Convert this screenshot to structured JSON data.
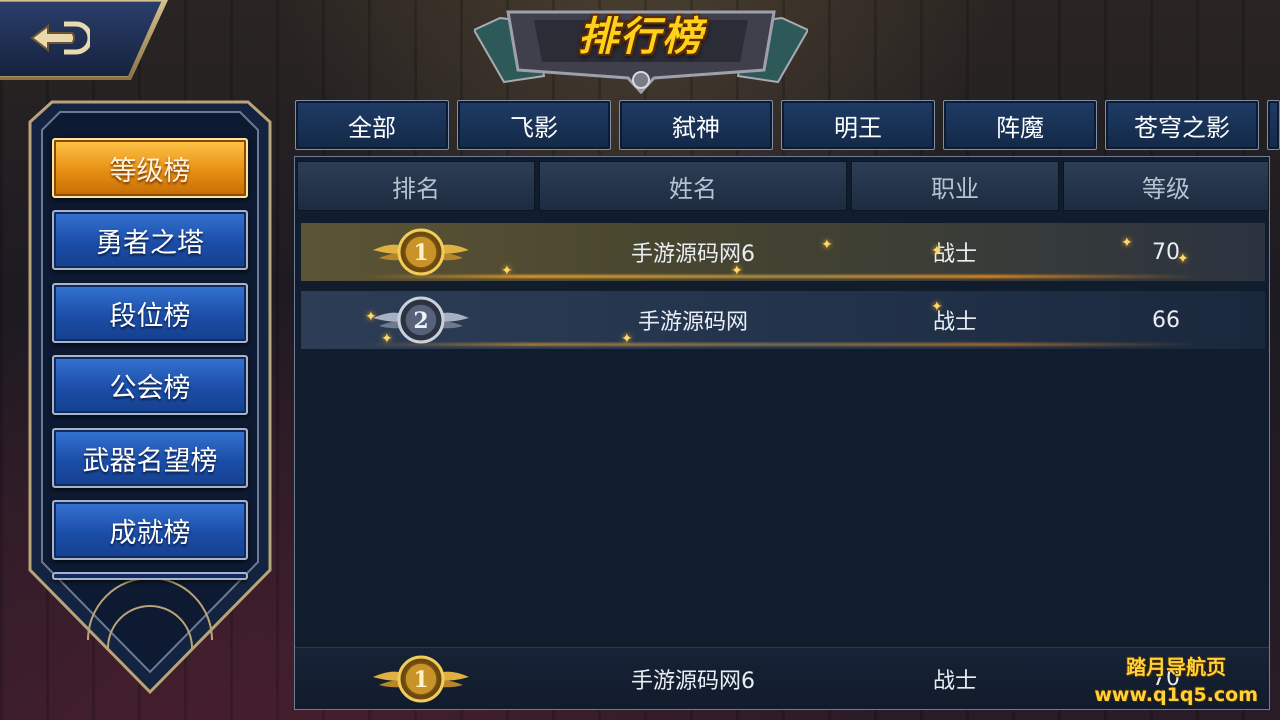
{
  "title": "排行榜",
  "sidebar": {
    "items": [
      {
        "label": "等级榜",
        "active": true
      },
      {
        "label": "勇者之塔",
        "active": false
      },
      {
        "label": "段位榜",
        "active": false
      },
      {
        "label": "公会榜",
        "active": false
      },
      {
        "label": "武器名望榜",
        "active": false
      },
      {
        "label": "成就榜",
        "active": false
      }
    ]
  },
  "tabs": [
    "全部",
    "飞影",
    "弑神",
    "明王",
    "阵魔",
    "苍穹之影"
  ],
  "table": {
    "headers": [
      "排名",
      "姓名",
      "职业",
      "等级"
    ],
    "rows": [
      {
        "rank": "1",
        "name": "手游源码网6",
        "class": "战士",
        "level": "70"
      },
      {
        "rank": "2",
        "name": "手游源码网",
        "class": "战士",
        "level": "66"
      }
    ],
    "self": {
      "rank": "1",
      "name": "手游源码网6",
      "class": "战士",
      "level": "70"
    }
  },
  "watermark": {
    "line1": "踏月导航页",
    "line2": "www.q1q5.com"
  },
  "colors": {
    "gold": "#ffd21a",
    "active_tab": "#e78f12",
    "button_blue": "#1b4ea8"
  }
}
